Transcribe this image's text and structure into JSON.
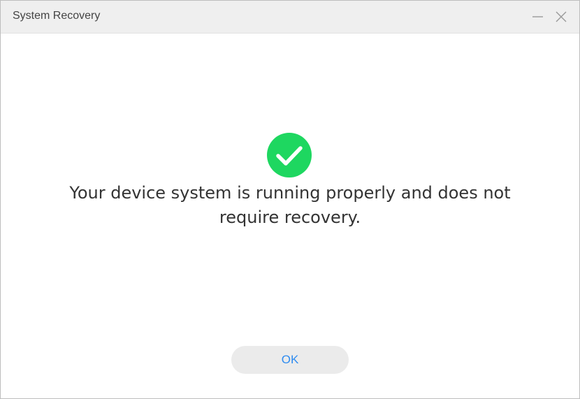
{
  "window": {
    "title": "System Recovery",
    "controls": {
      "minimize_icon": "minimize-icon",
      "close_icon": "close-icon"
    }
  },
  "status": {
    "icon": "check-circle-icon",
    "icon_color": "#1ed760",
    "message": "Your device system is running properly and does not require recovery."
  },
  "actions": {
    "ok_label": "OK",
    "ok_color": "#2f8cf0"
  }
}
